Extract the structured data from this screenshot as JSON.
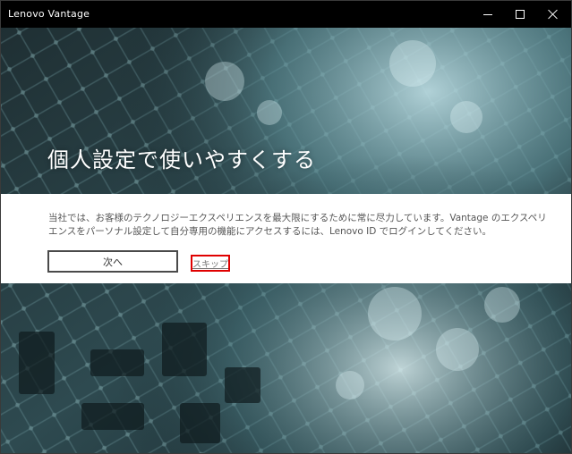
{
  "window": {
    "title": "Lenovo Vantage",
    "controls": {
      "minimize": "minimize-icon",
      "maximize": "maximize-icon",
      "close": "close-icon"
    }
  },
  "main": {
    "heading": "個人設定で使いやすくする",
    "description": "当社では、お客様のテクノロジーエクスペリエンスを最大限にするために常に尽力しています。Vantage のエクスペリエンスをパーソナル設定して自分専用の機能にアクセスするには、Lenovo ID でログインしてください。",
    "next_label": "次へ",
    "skip_label": "スキップ"
  },
  "colors": {
    "titlebar": "#000000",
    "panel": "#ffffff",
    "highlight": "#e00000"
  }
}
